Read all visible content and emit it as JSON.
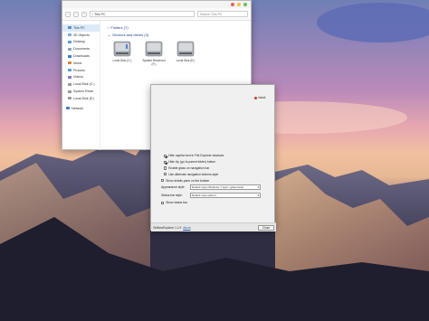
{
  "explorer": {
    "nav": {
      "back": "‹",
      "forward": "›",
      "up": "^"
    },
    "address": "› This PC",
    "search_placeholder": "Search This PC",
    "nav_items": [
      {
        "label": "This PC",
        "icon": "computer-icon",
        "color": "#5a8fd6"
      },
      {
        "label": "3D Objects",
        "icon": "folder-icon",
        "color": "#7ab0e0"
      },
      {
        "label": "Desktop",
        "icon": "folder-icon",
        "color": "#5c9ad6"
      },
      {
        "label": "Documents",
        "icon": "folder-icon",
        "color": "#8aa3bf"
      },
      {
        "label": "Downloads",
        "icon": "folder-icon",
        "color": "#3e7ccc"
      },
      {
        "label": "Music",
        "icon": "folder-icon",
        "color": "#d28a3b"
      },
      {
        "label": "Pictures",
        "icon": "folder-icon",
        "color": "#5aa0d8"
      },
      {
        "label": "Videos",
        "icon": "folder-icon",
        "color": "#7a7ad0"
      },
      {
        "label": "Local Disk (C:)",
        "icon": "drive-icon",
        "color": "#9a9a9a"
      },
      {
        "label": "System Reser",
        "icon": "drive-icon",
        "color": "#9a9a9a"
      },
      {
        "label": "Local Disk (E:)",
        "icon": "drive-icon",
        "color": "#9a9a9a"
      }
    ],
    "network_label": "Network",
    "group_folders": "Folders (7)",
    "group_devices": "Devices and drives (3)",
    "drives": [
      {
        "label": "Local Disk (C:)"
      },
      {
        "label": "System Reserved (F:)"
      },
      {
        "label": "Local Disk (E:)"
      }
    ]
  },
  "dialog": {
    "badge": "Install",
    "options": [
      {
        "label": "Hide caption text in File Explorer windows",
        "checked": true
      },
      {
        "label": "Hide Up (go to parent folder) button",
        "checked": true
      },
      {
        "label": "Enable glass on navigation bar",
        "checked": false
      },
      {
        "label": "Use alternate navigation buttons style",
        "checked": false
      },
      {
        "label": "Show details pane on the bottom",
        "checked": false
      }
    ],
    "appearance_label": "Appearance style:",
    "appearance_value": "Default style (Windows 7 style / glass bars)",
    "statusbar_label": "Status bar style:",
    "statusbar_value": "Default style (ahem)",
    "show_status_bar": "Show status bar",
    "version": "OldNewExplorer 1.1.9",
    "about": "About",
    "close": "Close"
  },
  "colors": {
    "close_dot": "#ec5f59",
    "min_dot": "#f5bd4f",
    "max_dot": "#61c554",
    "accent": "#1e3f8a"
  }
}
